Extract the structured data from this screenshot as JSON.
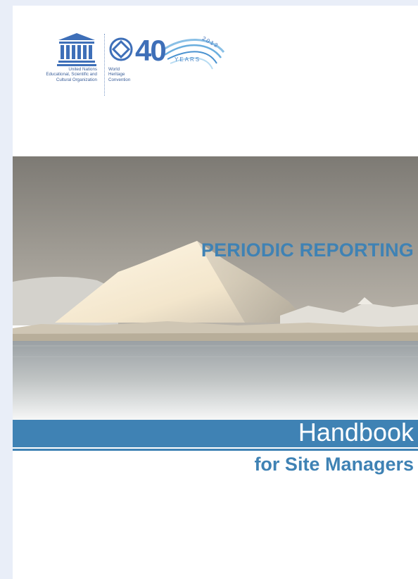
{
  "logos": {
    "unesco_wordmark": "UNESCO",
    "unesco_caption": [
      "United Nations",
      "Educational, Scientific and",
      "Cultural Organization"
    ],
    "whc_caption": [
      "World",
      "Heritage",
      "Convention"
    ],
    "anniversary_number": "40",
    "anniversary_years": "YEARS",
    "anniversary_year": "2012",
    "icons": [
      "unesco-temple-icon",
      "world-heritage-emblem-icon"
    ],
    "brand_color": "#3e6fb8"
  },
  "cover": {
    "image": "iceberg-landscape",
    "title_line_1": "PERIODIC REPORTING",
    "title_line_2": "Handbook",
    "title_line_3": "for Site Managers",
    "accent_color": "#3f82b4"
  }
}
